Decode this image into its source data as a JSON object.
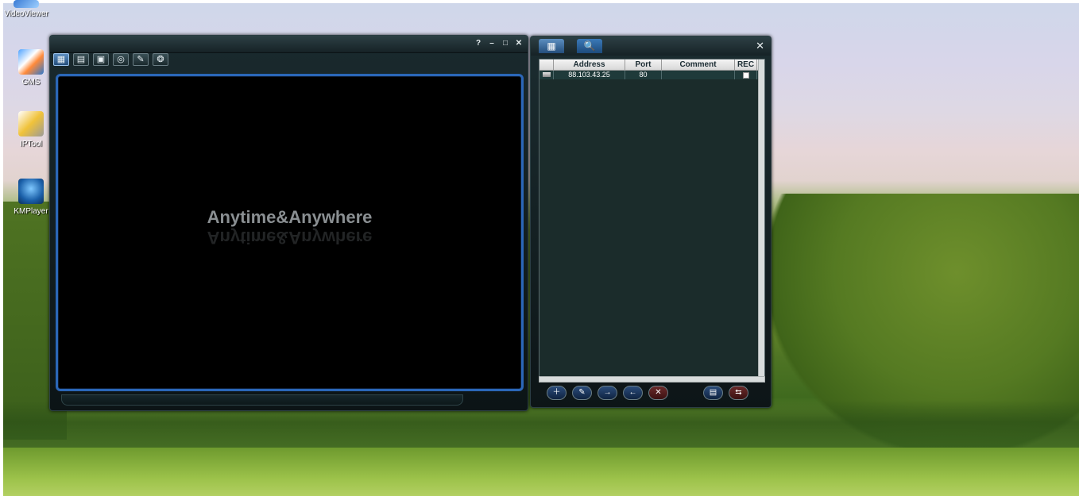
{
  "desktop": {
    "icons": [
      {
        "label": "VideoViewer"
      },
      {
        "label": "GMS"
      },
      {
        "label": "IPTool"
      },
      {
        "label": "KMPlayer"
      }
    ]
  },
  "viewer": {
    "window_controls": [
      "?",
      "–",
      "□",
      "✕"
    ],
    "toolbar": [
      "▦",
      "▤",
      "▣",
      "◎",
      "✎",
      "❂"
    ],
    "brand_text": "Anytime&Anywhere"
  },
  "address_book": {
    "tabs": [
      "▦",
      "🔍"
    ],
    "close_label": "✕",
    "columns": [
      "",
      "Address",
      "Port",
      "Comment",
      "REC"
    ],
    "rows": [
      {
        "address": "88.103.43.25",
        "port": "80",
        "comment": ""
      }
    ],
    "bottom_buttons": [
      "＋",
      "✎",
      "→",
      "←",
      "✕",
      "▤",
      "⇆"
    ]
  }
}
